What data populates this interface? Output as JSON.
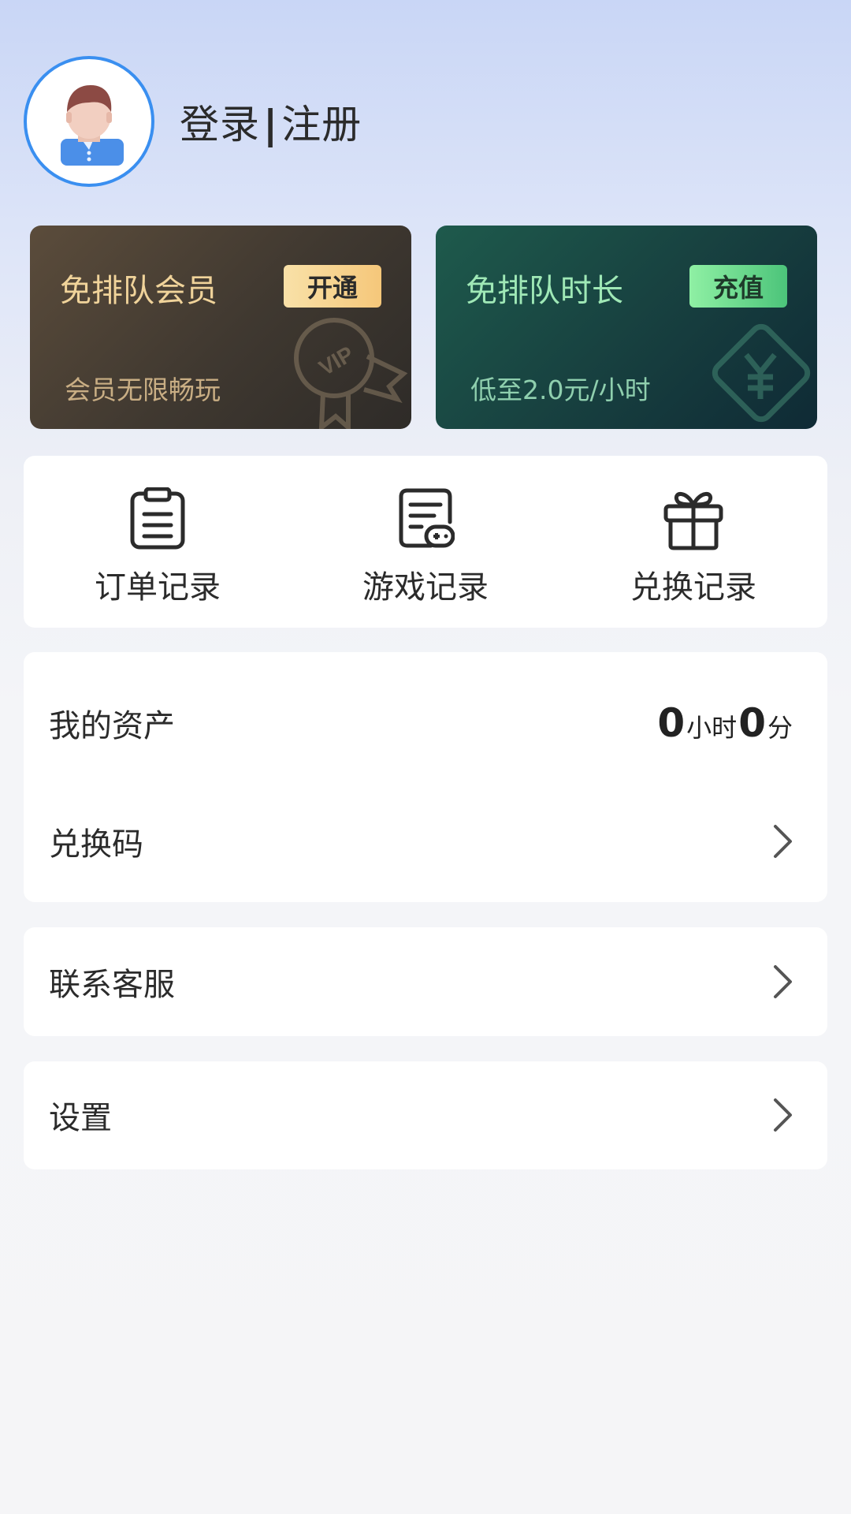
{
  "header": {
    "login_label": "登录",
    "separator": "|",
    "register_label": "注册"
  },
  "cards": [
    {
      "title": "免排队会员",
      "button": "开通",
      "subtitle": "会员无限畅玩",
      "badge_text": "VIP"
    },
    {
      "title": "免排队时长",
      "button": "充值",
      "subtitle": "低至2.0元/小时"
    }
  ],
  "shortcuts": [
    {
      "label": "订单记录",
      "icon": "clipboard-icon"
    },
    {
      "label": "游戏记录",
      "icon": "game-record-icon"
    },
    {
      "label": "兑换记录",
      "icon": "gift-icon"
    }
  ],
  "assets": {
    "label": "我的资产",
    "hours": "0",
    "hours_unit": "小时",
    "minutes": "0",
    "minutes_unit": "分"
  },
  "menu": {
    "redeem_code": "兑换码",
    "customer_service": "联系客服",
    "settings": "设置"
  },
  "colors": {
    "accent": "#3a8ff0",
    "vip_gold": "#f0d39a",
    "time_green": "#9fe8b6"
  }
}
